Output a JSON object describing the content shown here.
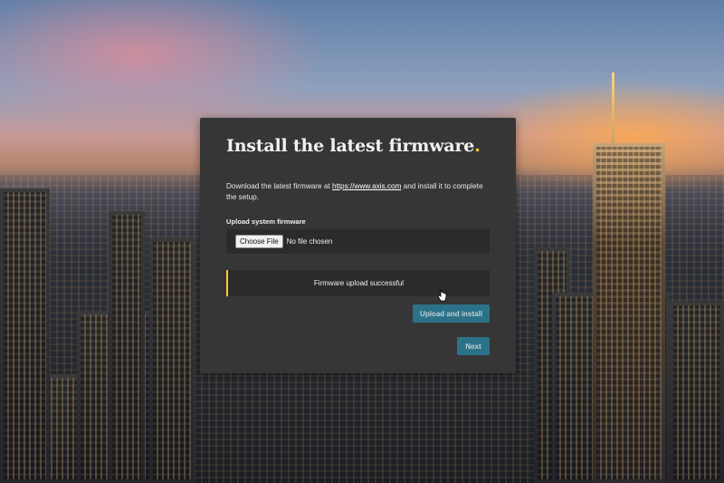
{
  "background": {
    "description_icon": "city-skyline-background"
  },
  "dialog": {
    "title_text": "Install the latest firmware",
    "title_dot": ".",
    "desc_prefix": "Download the latest firmware at ",
    "desc_link": "https://www.axis.com",
    "desc_suffix": " and install it to complete the setup.",
    "upload_label": "Upload system firmware",
    "choose_file_label": "Choose File",
    "file_status": "No file chosen",
    "notice_text": "Firmware upload successful",
    "upload_install_label": "Upload and install",
    "next_label": "Next"
  },
  "colors": {
    "accent": "#ffcc33",
    "button": "#2a7d98",
    "dialog_bg": "#363636",
    "field_bg": "#2b2b2b"
  }
}
